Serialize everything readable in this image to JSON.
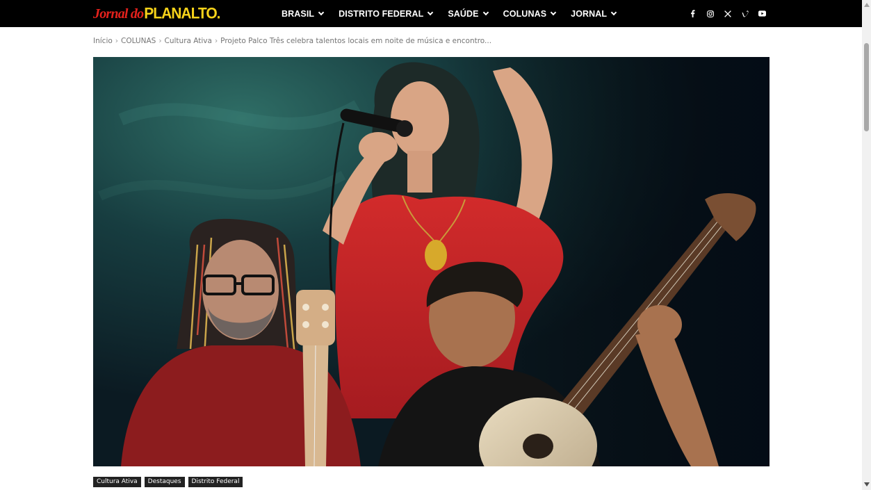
{
  "site": {
    "logo_part1": "Jornal do",
    "logo_part2": "PLANALTO."
  },
  "nav": {
    "items": [
      {
        "label": "BRASIL"
      },
      {
        "label": "DISTRITO FEDERAL"
      },
      {
        "label": "SAÚDE"
      },
      {
        "label": "COLUNAS"
      },
      {
        "label": "JORNAL"
      }
    ]
  },
  "social": [
    "facebook-icon",
    "instagram-icon",
    "x-icon",
    "vimeo-icon",
    "youtube-icon"
  ],
  "breadcrumb": {
    "items": [
      "Início",
      "COLUNAS",
      "Cultura Ativa",
      "Projeto Palco Três celebra talentos locais em noite de música e encontro..."
    ],
    "separator": "›"
  },
  "hero": {
    "alt": "hero-photo"
  },
  "tags": [
    "Cultura Ativa",
    "Destaques",
    "Distrito Federal"
  ],
  "colors": {
    "topbar": "#000000",
    "logo_red": "#e3211c",
    "logo_yellow": "#f6d21a",
    "tag_bg": "#222222"
  }
}
